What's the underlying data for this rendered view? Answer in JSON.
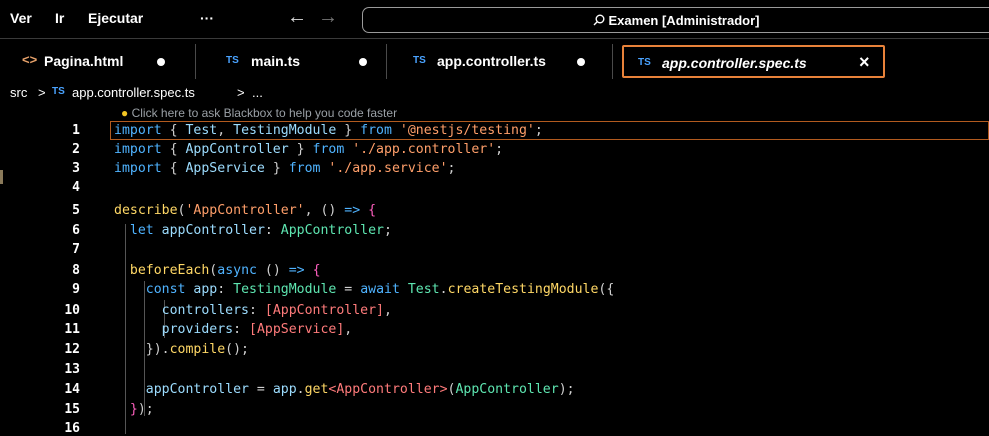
{
  "menubar": {
    "items": [
      "Ver",
      "Ir",
      "Ejecutar"
    ],
    "more": "···",
    "back": "←",
    "forward": "→",
    "search_icon": "⚲",
    "search_text": "Examen [Administrador]"
  },
  "tabs": [
    {
      "icon": "<>",
      "label": "Pagina.html",
      "modified": true
    },
    {
      "icon": "TS",
      "label": "main.ts",
      "modified": true
    },
    {
      "icon": "TS",
      "label": "app.controller.ts",
      "modified": true
    },
    {
      "icon": "TS",
      "label": "app.controller.spec.ts",
      "active": true,
      "close": "×"
    }
  ],
  "breadcrumb": {
    "folder": "src",
    "sep1": ">",
    "file_icon": "TS",
    "file": "app.controller.spec.ts",
    "sep2": ">",
    "more": "..."
  },
  "editor": {
    "hint": "Click here to ask Blackbox to help you code faster",
    "line_numbers": [
      "1",
      "2",
      "3",
      "4",
      "5",
      "6",
      "7",
      "8",
      "9",
      "10",
      "11",
      "12",
      "13",
      "14",
      "15",
      "16"
    ]
  },
  "colors": {
    "keyword": "#4fb3ff",
    "function": "#ffd866",
    "string": "#ff9f6a",
    "type": "#5ee6b1",
    "active_tab_border": "#e8823a"
  }
}
